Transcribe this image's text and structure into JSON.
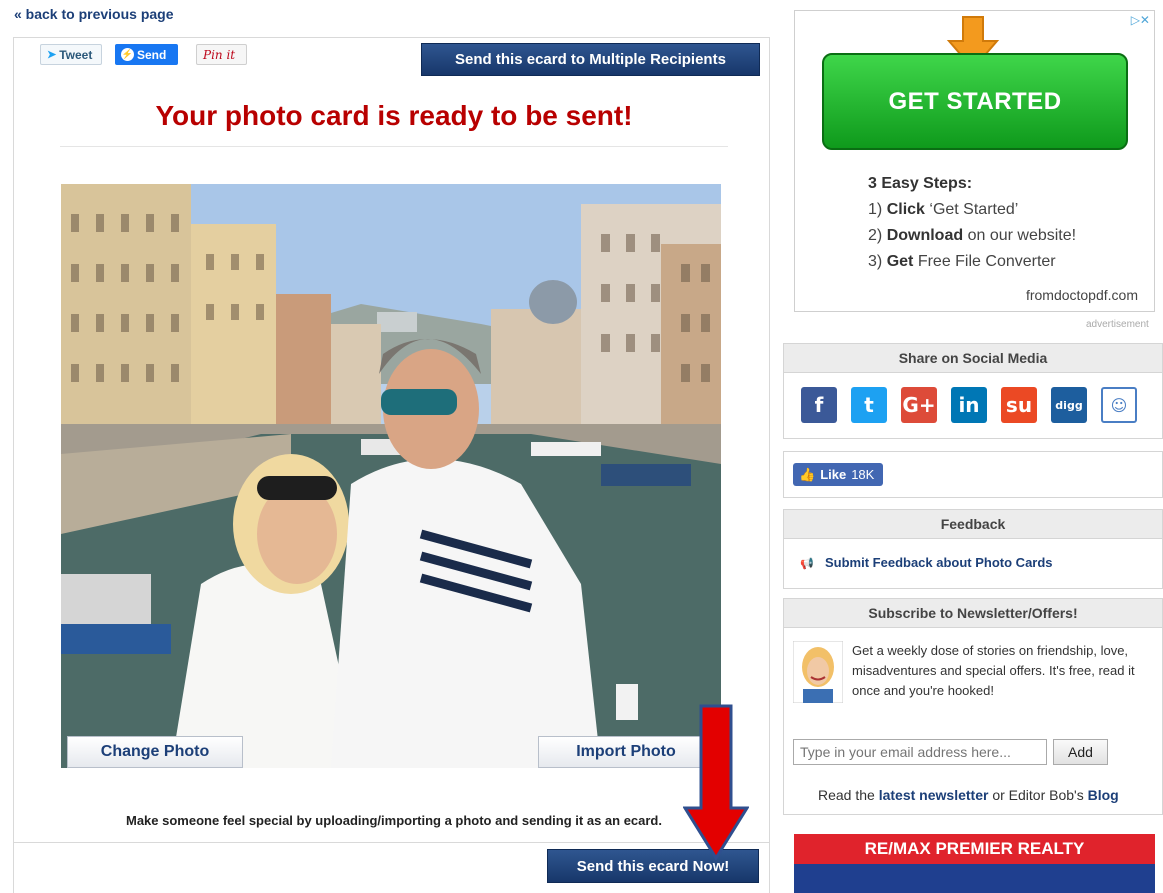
{
  "nav": {
    "back_link": "« back to previous page"
  },
  "share": {
    "tweet": "Tweet",
    "send": "Send",
    "pin": "Pin it",
    "multi_recipients": "Send this ecard to Multiple Recipients"
  },
  "main": {
    "title": "Your photo card is ready to be sent!",
    "change_photo": "Change Photo",
    "import_photo": "Import Photo",
    "caption": "Make someone feel special by uploading/importing a photo and sending it as an ecard.",
    "send_now": "Send this ecard Now!"
  },
  "ad": {
    "corner": "▷✕",
    "cta": "GET STARTED",
    "steps_title": "3 Easy Steps:",
    "step1_num": "1)",
    "step1_bold": "Click",
    "step1_rest": "‘Get Started’",
    "step2_num": "2)",
    "step2_bold": "Download",
    "step2_rest": "on our website!",
    "step3_num": "3)",
    "step3_bold": "Get",
    "step3_rest": "Free File Converter",
    "domain": "fromdoctopdf.com",
    "label": "advertisement"
  },
  "social": {
    "heading": "Share on Social Media",
    "icons": [
      {
        "name": "facebook-icon",
        "glyph": "f",
        "color": "#3b5998"
      },
      {
        "name": "twitter-icon",
        "glyph": "t",
        "color": "#1da1f2"
      },
      {
        "name": "google-plus-icon",
        "glyph": "G+",
        "color": "#dd4b39"
      },
      {
        "name": "linkedin-icon",
        "glyph": "in",
        "color": "#0077b5"
      },
      {
        "name": "stumbleupon-icon",
        "glyph": "su",
        "color": "#eb4924"
      },
      {
        "name": "digg-icon",
        "glyph": "digg",
        "color": "#1d5e9e"
      },
      {
        "name": "reddit-icon",
        "glyph": "☺",
        "color": "#ffffff"
      }
    ]
  },
  "like": {
    "label": "Like",
    "count": "18K"
  },
  "feedback": {
    "heading": "Feedback",
    "link": "Submit Feedback about Photo Cards"
  },
  "newsletter": {
    "heading": "Subscribe to Newsletter/Offers!",
    "text": "Get a weekly dose of stories on friendship, love, misadventures and special offers. It's free, read it once and you're hooked!",
    "email_placeholder": "Type in your email address here...",
    "add": "Add",
    "read_prefix": "Read the",
    "latest_link": "latest newsletter",
    "read_middle": "or Editor Bob's",
    "blog_link": "Blog"
  },
  "realty": {
    "heading": "RE/MAX PREMIER REALTY"
  },
  "colors": {
    "brand_blue": "#1c3f78",
    "title_red": "#b80000",
    "cta_green": "#1cb529"
  }
}
